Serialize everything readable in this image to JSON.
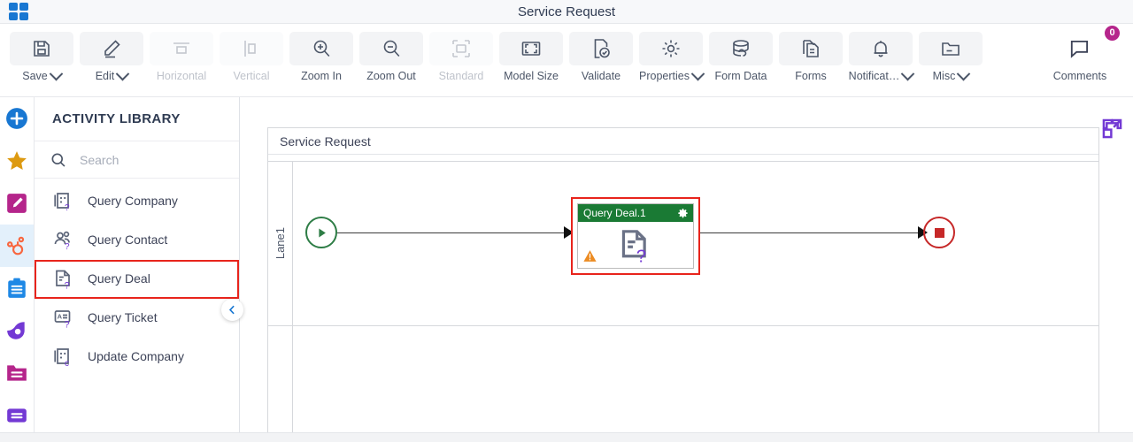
{
  "window": {
    "title": "Service Request",
    "logo_icon": "app-grid-icon"
  },
  "toolbar": {
    "items": [
      {
        "label": "Save",
        "icon": "floppy-disk-icon",
        "caret": true,
        "disabled": false
      },
      {
        "label": "Edit",
        "icon": "pencil-icon",
        "caret": true,
        "disabled": false
      },
      {
        "label": "Horizontal",
        "icon": "horizontal-align-icon",
        "caret": false,
        "disabled": true
      },
      {
        "label": "Vertical",
        "icon": "vertical-align-icon",
        "caret": false,
        "disabled": true
      },
      {
        "label": "Zoom In",
        "icon": "zoom-in-icon",
        "caret": false,
        "disabled": false
      },
      {
        "label": "Zoom Out",
        "icon": "zoom-out-icon",
        "caret": false,
        "disabled": false
      },
      {
        "label": "Standard",
        "icon": "standard-size-icon",
        "caret": false,
        "disabled": true
      },
      {
        "label": "Model Size",
        "icon": "model-size-icon",
        "caret": false,
        "disabled": false
      },
      {
        "label": "Validate",
        "icon": "validate-icon",
        "caret": false,
        "disabled": false
      },
      {
        "label": "Properties",
        "icon": "gear-icon",
        "caret": true,
        "disabled": false
      },
      {
        "label": "Form Data",
        "icon": "database-icon",
        "caret": false,
        "disabled": false
      },
      {
        "label": "Forms",
        "icon": "forms-icon",
        "caret": false,
        "disabled": false
      },
      {
        "label": "Notificat…",
        "icon": "bell-icon",
        "caret": true,
        "disabled": false
      },
      {
        "label": "Misc",
        "icon": "folder-icon",
        "caret": true,
        "disabled": false
      }
    ],
    "comments": {
      "label": "Comments",
      "icon": "comment-icon",
      "badge_count": "0",
      "badge_color": "#b5258b"
    }
  },
  "rail": {
    "items": [
      {
        "name": "add",
        "icon": "plus-circle-icon",
        "color": "#1877d2",
        "selected": false
      },
      {
        "name": "favorites",
        "icon": "star-icon",
        "color": "#dd9a11",
        "selected": false
      },
      {
        "name": "design",
        "icon": "edit-square-icon",
        "color": "#b5258b",
        "selected": false
      },
      {
        "name": "hubspot",
        "icon": "hubspot-icon",
        "color": "#f8663f",
        "selected": true
      },
      {
        "name": "tasks",
        "icon": "clipboard-icon",
        "color": "#1e88e5",
        "selected": false
      },
      {
        "name": "automation",
        "icon": "automation-icon",
        "color": "#7339d4",
        "selected": false
      },
      {
        "name": "folders",
        "icon": "folder-list-icon",
        "color": "#b5258b",
        "selected": false
      },
      {
        "name": "records",
        "icon": "records-icon",
        "color": "#7339d4",
        "selected": false
      }
    ]
  },
  "library": {
    "title": "ACTIVITY LIBRARY",
    "search": {
      "value": "",
      "placeholder": "Search",
      "icon": "search-icon"
    },
    "collapse_icon": "chevron-left-icon",
    "items": [
      {
        "label": "Query Company",
        "icon": "query-company-icon",
        "highlighted": false
      },
      {
        "label": "Query Contact",
        "icon": "query-contact-icon",
        "highlighted": false
      },
      {
        "label": "Query Deal",
        "icon": "query-deal-icon",
        "highlighted": true
      },
      {
        "label": "Query Ticket",
        "icon": "query-ticket-icon",
        "highlighted": false
      },
      {
        "label": "Update Company",
        "icon": "update-company-icon",
        "highlighted": false
      }
    ],
    "highlight_color": "#e8241c"
  },
  "canvas": {
    "pool_title": "Service Request",
    "lanes": [
      {
        "label": "Lane1"
      },
      {
        "label": ""
      }
    ],
    "expand_icon": "expand-diagram-icon",
    "nodes": {
      "start_event": {
        "icon": "start-event-icon",
        "color": "#2e7d46"
      },
      "end_event": {
        "icon": "end-event-icon",
        "color": "#c62828"
      },
      "task": {
        "name": "Query Deal.1",
        "header_color": "#1a7a34",
        "selected": true,
        "selection_color": "#e8241c",
        "gear_icon": "gear-icon",
        "warning_icon": "warning-icon",
        "body_icon": "query-deal-icon"
      }
    }
  }
}
